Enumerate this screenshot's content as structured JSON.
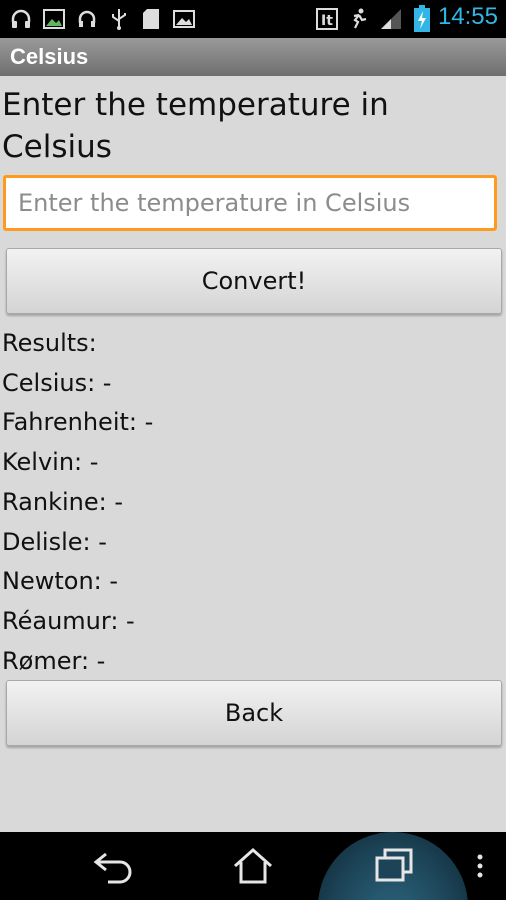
{
  "status_bar": {
    "time": "14:55",
    "icons": [
      "headphones-icon",
      "screenshot-icon",
      "headset-icon",
      "usb-icon",
      "sd-card-icon",
      "image-icon",
      "it-icon",
      "running-icon",
      "signal-icon",
      "battery-charging-icon"
    ]
  },
  "title_bar": {
    "title": "Celsius"
  },
  "main": {
    "heading": "Enter the temperature in Celsius",
    "input_placeholder": "Enter the temperature in Celsius",
    "input_value": "",
    "convert_label": "Convert!",
    "results": {
      "header": "Results:",
      "celsius": "Celsius: -",
      "fahrenheit": "Fahrenheit: -",
      "kelvin": "Kelvin: -",
      "rankine": "Rankine: -",
      "delisle": "Delisle: -",
      "newton": "Newton: -",
      "reaumur": "Réaumur: -",
      "romer": "Rømer: -"
    },
    "back_label": "Back"
  },
  "colors": {
    "input_focus_border": "#ff9a1f",
    "clock": "#33b5e5",
    "background": "#d9d9d9"
  },
  "nav_bar": {
    "icons": [
      "back-nav-icon",
      "home-nav-icon",
      "recent-apps-icon",
      "overflow-menu-icon"
    ]
  }
}
